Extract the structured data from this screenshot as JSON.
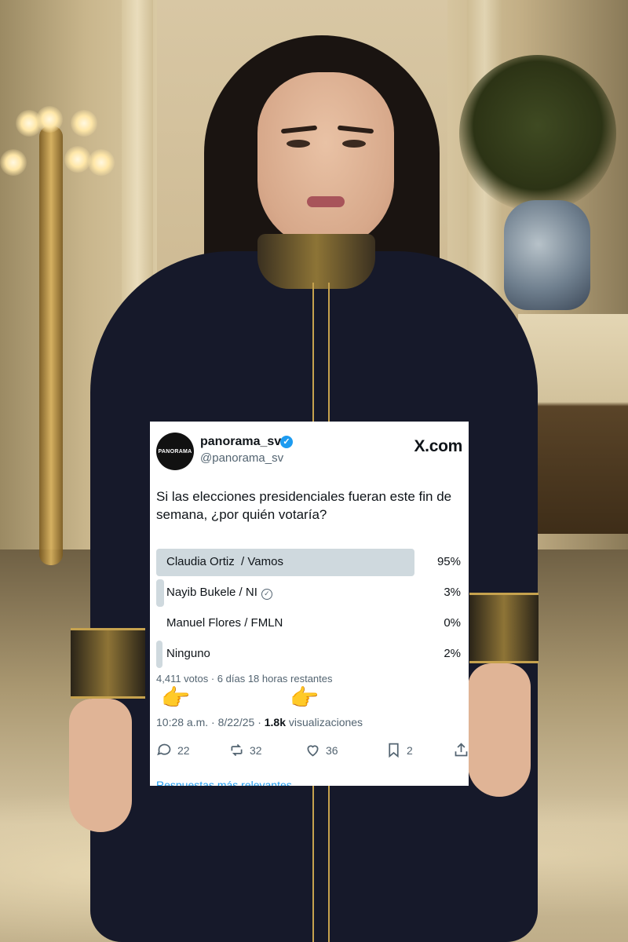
{
  "tweet": {
    "display_name": "panorama_sv",
    "handle": "@panorama_sv",
    "avatar_text": "PANORAMA",
    "source_logo": "X.com",
    "text": "Si las elecciones presidenciales fueran este fin de semana, ¿por quién votaría?",
    "poll": {
      "options": [
        {
          "label": "Claudia Ortiz  / Vamos",
          "percent": "95%",
          "fill_fraction": 0.95
        },
        {
          "label": "Nayib Bukele / NI",
          "percent": "3%",
          "fill_fraction": 0.03,
          "badge_icon": "check-circle-icon"
        },
        {
          "label": "Manuel Flores / FMLN",
          "percent": "0%",
          "fill_fraction": 0.0
        },
        {
          "label": "Ninguno",
          "percent": "2%",
          "fill_fraction": 0.02
        }
      ],
      "meta": "4,411 votos · 6 días 18 horas restantes"
    },
    "timestamp": {
      "time_date": "10:28 a.m. · 8/22/25 · ",
      "views_count": "1.8k",
      "views_label": " visualizaciones"
    },
    "actions": {
      "replies": "22",
      "reposts": "32",
      "likes": "36",
      "bookmarks": "2"
    },
    "more_replies": "Respuestas más relevantes ⌄"
  },
  "colors": {
    "verified_blue": "#1d9bf0",
    "poll_fill": "#cfd9de",
    "secondary_text": "#536471",
    "coat_navy": "#16192a",
    "gold_trim": "#c6a24e"
  }
}
